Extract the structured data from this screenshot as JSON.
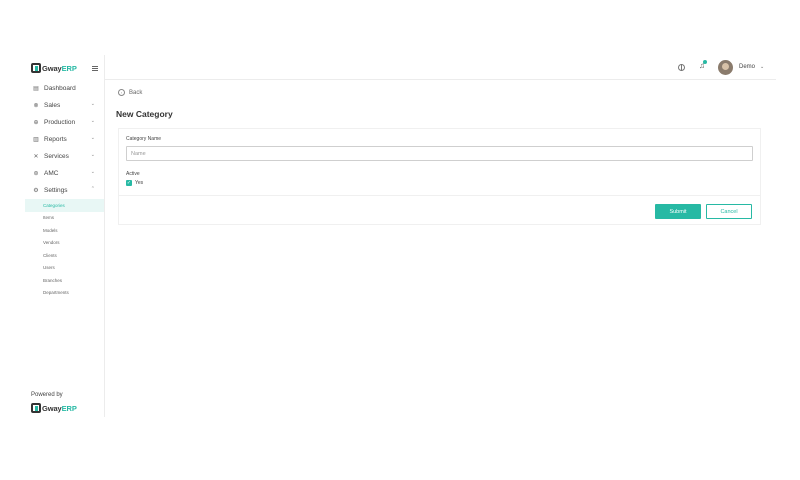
{
  "brand": {
    "name_part1": "Gway",
    "name_part2": "ERP",
    "accent": "#27b9a4"
  },
  "sidebar": {
    "items": [
      {
        "label": "Dashboard",
        "icon": "dashboard-icon",
        "chevron": ""
      },
      {
        "label": "Sales",
        "icon": "sales-icon",
        "chevron": "⌄"
      },
      {
        "label": "Production",
        "icon": "production-icon",
        "chevron": "⌄"
      },
      {
        "label": "Reports",
        "icon": "reports-icon",
        "chevron": "⌄"
      },
      {
        "label": "Services",
        "icon": "services-icon",
        "chevron": "⌄"
      },
      {
        "label": "AMC",
        "icon": "amc-icon",
        "chevron": "⌄"
      },
      {
        "label": "Settings",
        "icon": "settings-icon",
        "chevron": "⌃"
      }
    ],
    "submenu": [
      {
        "label": "Categories",
        "active": true
      },
      {
        "label": "Items",
        "active": false
      },
      {
        "label": "Models",
        "active": false
      },
      {
        "label": "Vendors",
        "active": false
      },
      {
        "label": "Clients",
        "active": false
      },
      {
        "label": "Users",
        "active": false
      },
      {
        "label": "Branches",
        "active": false
      },
      {
        "label": "Departments",
        "active": false
      }
    ],
    "powered_by": "Powered by"
  },
  "topbar": {
    "icons": [
      "globe-icon",
      "bell-icon",
      "user-avatar"
    ],
    "user_name": "Demo",
    "chevron": "⌄"
  },
  "main": {
    "back_label": "Back",
    "page_title": "New Category",
    "form": {
      "category_name_label": "Category Name",
      "category_name_placeholder": "Name",
      "category_name_value": "",
      "active_label": "Active",
      "active_option": "Yes",
      "active_checked": true,
      "submit_label": "Submit",
      "cancel_label": "Cancel"
    }
  }
}
